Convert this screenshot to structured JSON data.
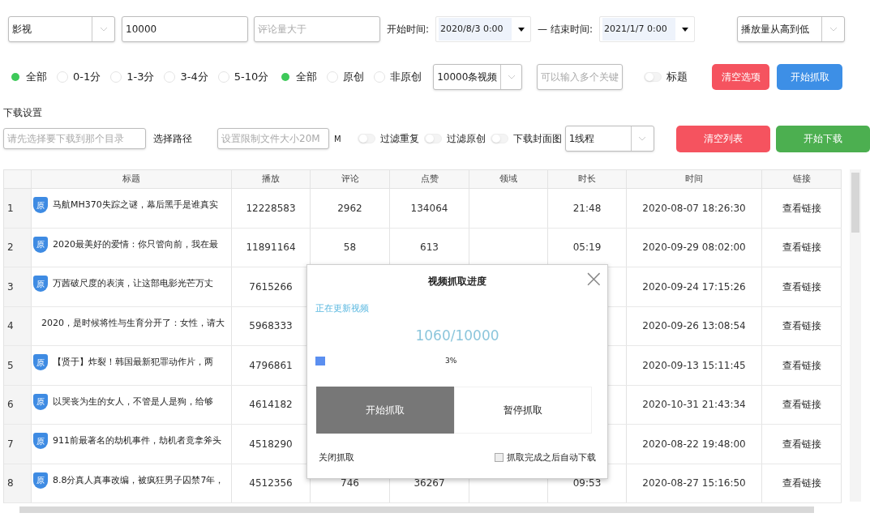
{
  "filters": {
    "category": "影视",
    "min_plays": {
      "value": "10000"
    },
    "min_comments": {
      "placeholder": "评论量大于"
    },
    "start_label": "开始时间:",
    "start_date": "2020/8/3 0:00",
    "dash": "—",
    "end_label": "结束时间:",
    "end_date": "2021/1/7 0:00",
    "sort": "播放量从高到低"
  },
  "duration_options": [
    {
      "label": "全部",
      "selected": true
    },
    {
      "label": "0-1分",
      "selected": false
    },
    {
      "label": "1-3分",
      "selected": false
    },
    {
      "label": "3-4分",
      "selected": false
    },
    {
      "label": "5-10分",
      "selected": false
    }
  ],
  "origin_options": [
    {
      "label": "全部",
      "selected": true
    },
    {
      "label": "原创",
      "selected": false
    },
    {
      "label": "非原创",
      "selected": false
    }
  ],
  "count_select": "10000条视频",
  "keyword_field": {
    "placeholder": "可以输入多个关键"
  },
  "title_switch": {
    "label": "标题",
    "on": false
  },
  "buttons": [
    {
      "label": "清空选项",
      "kind": "danger"
    },
    {
      "label": "开始抓取",
      "kind": "primary"
    }
  ],
  "download": {
    "title": "下载设置",
    "path_field": {
      "placeholder": "请先选择要下载到那个目录"
    },
    "path_button": "选择路径",
    "size_field": {
      "placeholder": "设置限制文件大小20M"
    },
    "unit": "M",
    "switches": [
      {
        "label": "过滤重复",
        "on": false
      },
      {
        "label": "过滤原创",
        "on": false
      },
      {
        "label": "下载封面图",
        "on": false
      }
    ],
    "threads": "1线程",
    "buttons": [
      {
        "label": "清空列表",
        "kind": "danger"
      },
      {
        "label": "开始下载",
        "kind": "success"
      }
    ]
  },
  "table": {
    "columns": [
      "标题",
      "播放",
      "评论",
      "点赞",
      "领域",
      "时长",
      "时间",
      "链接"
    ],
    "rows": [
      {
        "index": "1",
        "badge": "原",
        "title": "马航MH370失踪之谜，幕后黑手是谁真实",
        "plays": "12228583",
        "comments": "2962",
        "likes": "134064",
        "duration": "21:48",
        "time": "2020-08-07 18:26:30",
        "link": "查看链接"
      },
      {
        "index": "2",
        "badge": "原",
        "title": "2020最美好的爱情：你只管向前，我在最",
        "plays": "11891164",
        "comments": "58",
        "likes": "613",
        "duration": "05:19",
        "time": "2020-09-29 08:02:00",
        "link": "查看链接"
      },
      {
        "index": "3",
        "badge": "原",
        "title": "万茜破尺度的表演，让这部电影光芒万丈",
        "plays": "7615266",
        "time": "2020-09-24 17:15:26",
        "link": "查看链接"
      },
      {
        "index": "4",
        "title": "2020，是时候将性与生育分开了：女性，请大",
        "plays": "5968333",
        "time": "2020-09-26 13:08:54",
        "link": "查看链接"
      },
      {
        "index": "5",
        "badge": "原",
        "title": "【贤于】炸裂！韩国最新犯罪动作片，两",
        "plays": "4796861",
        "time": "2020-09-13 15:11:45",
        "link": "查看链接"
      },
      {
        "index": "6",
        "badge": "原",
        "title": "以哭丧为生的女人，不管是人是狗，给够",
        "plays": "4614182",
        "time": "2020-10-31 21:43:34",
        "link": "查看链接"
      },
      {
        "index": "7",
        "badge": "原",
        "title": "911前最著名的劫机事件，劫机者竟拿斧头",
        "plays": "4518290",
        "time": "2020-08-22 19:48:00",
        "link": "查看链接"
      },
      {
        "index": "8",
        "badge": "原",
        "title": "8.8分真人真事改编，被疯狂男子囚禁7年，",
        "plays": "4512356",
        "comments": "746",
        "likes": "36267",
        "duration": "09:53",
        "time": "2020-08-27 15:16:50",
        "link": "查看链接"
      }
    ]
  },
  "dialog": {
    "title": "视频抓取进度",
    "close": "×",
    "status": "正在更新视频",
    "count": "1060/10000",
    "level": 0.03,
    "percent": "3%",
    "buttons": [
      {
        "label": "开始抓取",
        "selected": true
      },
      {
        "label": "暂停抓取",
        "selected": false
      }
    ],
    "close_link": "关闭抓取",
    "auto_download": {
      "label": "抓取完成之后自动下载",
      "checked": false
    }
  }
}
